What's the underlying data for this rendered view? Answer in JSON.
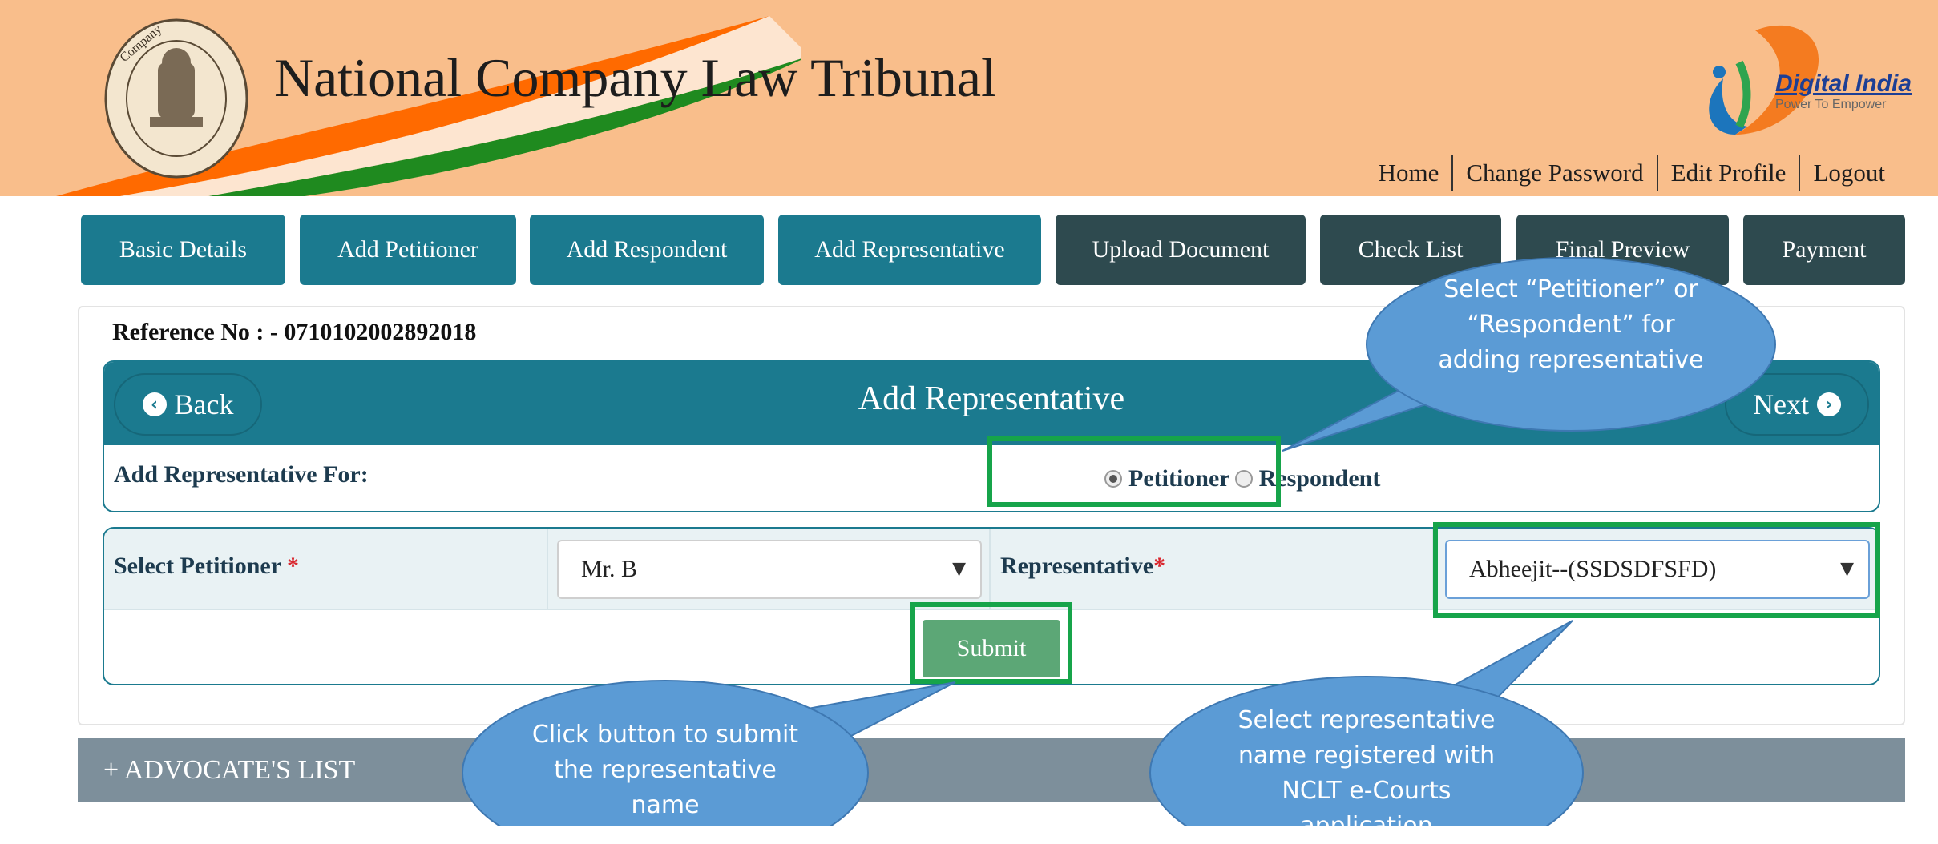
{
  "header": {
    "site_title": "National Company Law Tribunal",
    "emblem_text": "National Company Law Tribunal",
    "digital_india_title": "Digital India",
    "digital_india_tagline": "Power To Empower",
    "links": [
      "Home",
      "Change Password",
      "Edit Profile",
      "Logout"
    ]
  },
  "tabs": [
    {
      "label": "Basic Details",
      "state": "done"
    },
    {
      "label": "Add Petitioner",
      "state": "done"
    },
    {
      "label": "Add Respondent",
      "state": "done"
    },
    {
      "label": "Add Representative",
      "state": "done"
    },
    {
      "label": "Upload Document",
      "state": "todo"
    },
    {
      "label": "Check List",
      "state": "todo"
    },
    {
      "label": "Final Preview",
      "state": "todo"
    },
    {
      "label": "Payment",
      "state": "todo"
    }
  ],
  "main": {
    "reference_no": "Reference No : - 0710102002892018",
    "section_title": "Add Representative",
    "back_label": "Back",
    "next_label": "Next",
    "add_for_label": "Add Representative For:",
    "radio_options": [
      {
        "label": "Petitioner",
        "checked": true
      },
      {
        "label": "Respondent",
        "checked": false
      }
    ],
    "select_petitioner_label": "Select Petitioner ",
    "select_petitioner_value": "Mr. B",
    "representative_label": "Representative",
    "representative_value": "Abheejit--(SSDSDFSFD)",
    "required_mark": "*",
    "submit_label": "Submit"
  },
  "advocate_list": {
    "label": "+ ADVOCATE'S LIST"
  },
  "callouts": {
    "radio_hint": "Select “Petitioner” or “Respondent” for adding representative",
    "submit_hint": "Click button to submit the representative name",
    "representative_hint": "Select representative name registered with NCLT e-Courts application"
  },
  "colors": {
    "header_bg": "#f9be8b",
    "tab_done": "#1b7a8f",
    "tab_todo": "#2e4a4f",
    "highlight": "#16a44a",
    "callout_fill": "#5b9bd5",
    "submit_green": "#5ca776"
  },
  "icons": {
    "back": "chevron-left-circle-icon",
    "next": "chevron-right-circle-icon",
    "dropdown": "caret-down-icon"
  }
}
